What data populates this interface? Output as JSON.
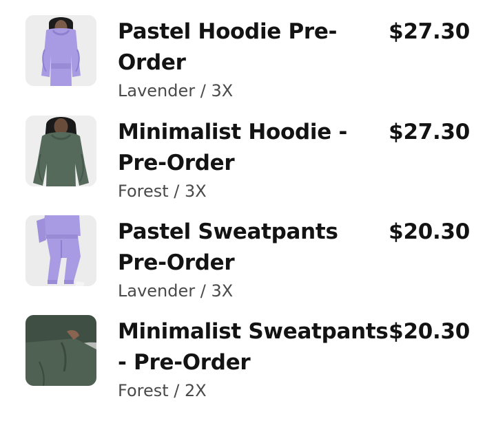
{
  "cart": {
    "items": [
      {
        "title_line1": "Pastel Hoodie Pre-",
        "title_line2": "Order",
        "variant": "Lavender / 3X",
        "price": "$27.30",
        "thumbnail_icon": "lavender-hoodie-photo",
        "color": "#a99be3"
      },
      {
        "title_line1": "Minimalist Hoodie -",
        "title_line2": "Pre-Order",
        "variant": "Forest / 3X",
        "price": "$27.30",
        "thumbnail_icon": "forest-hoodie-photo",
        "color": "#566a5c"
      },
      {
        "title_line1": "Pastel Sweatpants",
        "title_line2": "Pre-Order",
        "variant": "Lavender / 3X",
        "price": "$20.30",
        "thumbnail_icon": "lavender-sweatpants-photo",
        "color": "#a99be3"
      },
      {
        "title_line1": "Minimalist Sweatpants",
        "title_line2": "- Pre-Order",
        "variant": "Forest / 2X",
        "price": "$20.30",
        "thumbnail_icon": "forest-sweatpants-photo",
        "color": "#4f6152"
      }
    ]
  }
}
